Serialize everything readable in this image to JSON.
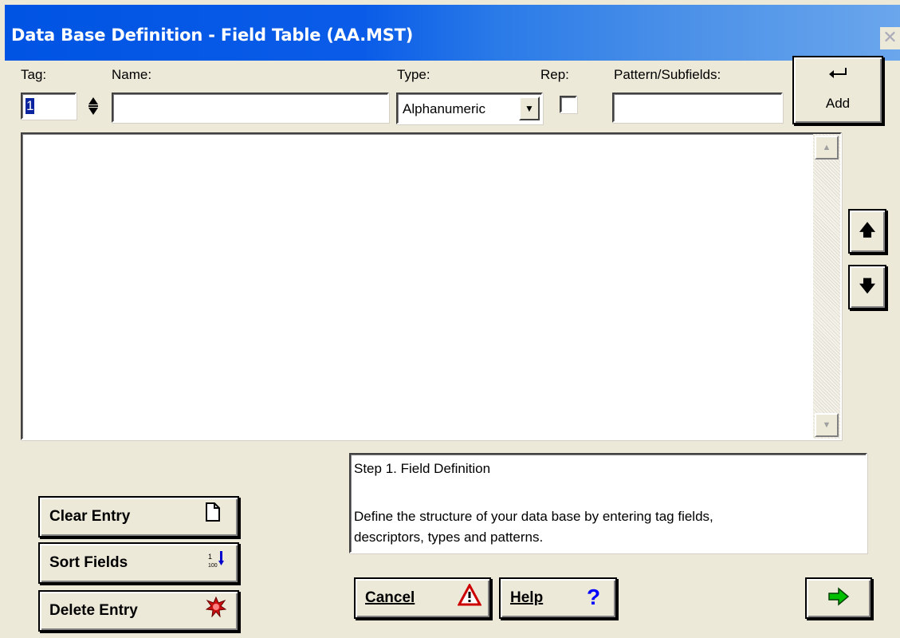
{
  "window": {
    "title": "Data Base Definition - Field Table (AA.MST)"
  },
  "icons": {
    "close": "close-icon",
    "enter": "enter-arrow-icon",
    "spin": "spin-updown-icon",
    "dropdown": "chevron-down-icon",
    "up": "arrow-up-icon",
    "down": "arrow-down-icon",
    "new_document": "new-document-icon",
    "sort": "sort-numbers-icon",
    "delete": "delete-burst-icon",
    "warning": "warning-triangle-icon",
    "help": "question-mark-icon",
    "next": "green-right-arrow-icon"
  },
  "colors": {
    "title_bar": "#0054e3",
    "window_bg": "#ece9d8",
    "selection": "#0a24a0",
    "next_arrow": "#00a000",
    "warning": "#cc0000",
    "help": "#0000ff"
  },
  "fields": {
    "tag_label": "Tag:",
    "tag_value": "1",
    "name_label": "Name:",
    "name_value": "",
    "type_label": "Type:",
    "type_value": "Alphanumeric",
    "rep_label": "Rep:",
    "rep_checked": false,
    "pattern_label": "Pattern/Subfields:",
    "pattern_value": ""
  },
  "buttons": {
    "add": "Add",
    "clear_entry": "Clear Entry",
    "sort_fields": "Sort Fields",
    "delete_entry": "Delete Entry",
    "cancel": "Cancel",
    "help": "Help"
  },
  "field_list": [],
  "info": {
    "step": "Step 1. Field Definition",
    "line1": "Define the structure of your data base by entering tag fields,",
    "line2": "descriptors, types and patterns."
  }
}
